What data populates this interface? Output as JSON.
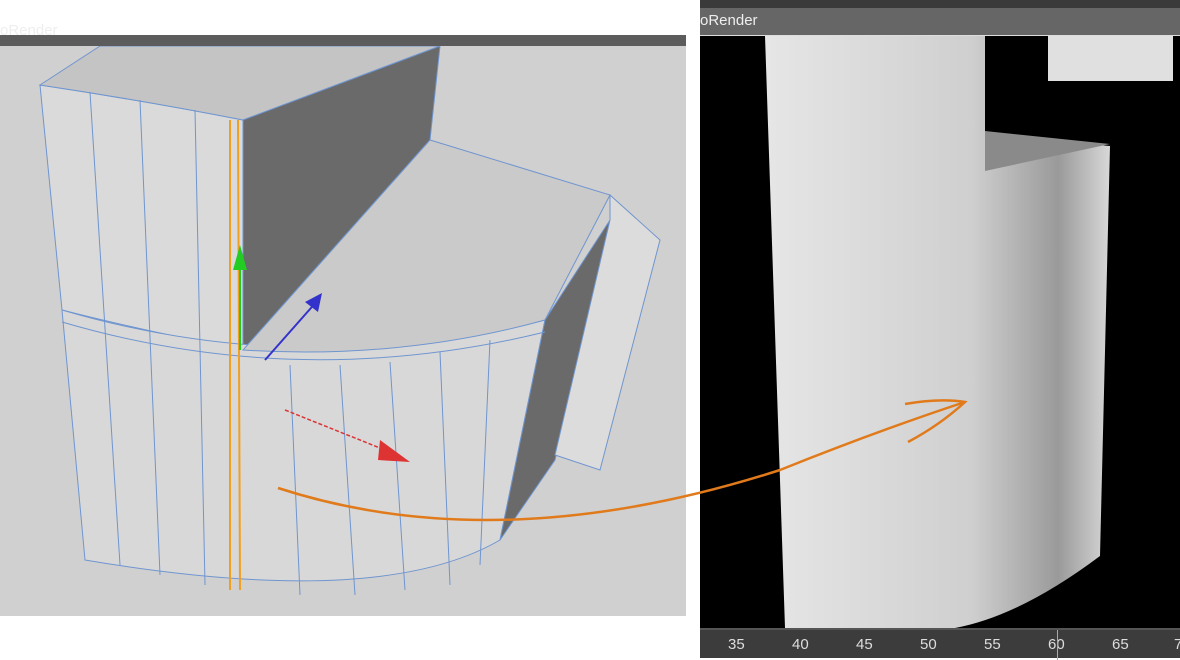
{
  "left_viewport": {
    "title": "oRender"
  },
  "right_viewport": {
    "title": "oRender"
  },
  "timeline": {
    "ticks": [
      "35",
      "40",
      "45",
      "50",
      "55",
      "60",
      "65",
      "7"
    ],
    "current_frame": "60"
  },
  "colors": {
    "annotation_arrow": "#e07a1a",
    "selection": "#f0a020",
    "wire": "#6f95d0"
  }
}
